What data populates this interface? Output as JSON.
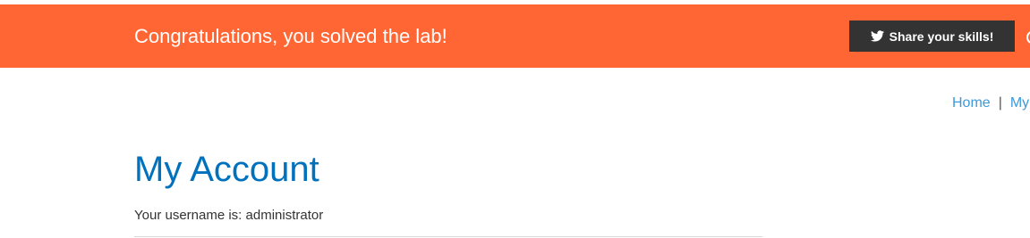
{
  "banner": {
    "title": "Congratulations, you solved the lab!",
    "share_label": "Share your skills!",
    "background": "#ff6633",
    "share_icon": "twitter-bird-icon"
  },
  "nav": {
    "home_label": "Home",
    "separator": "|",
    "account_label": "My"
  },
  "main": {
    "title": "My Account",
    "username_text": "Your username is: administrator"
  },
  "colors": {
    "link": "#3d99d8",
    "heading": "#0071bc",
    "text": "#333333",
    "button": "#333333"
  }
}
